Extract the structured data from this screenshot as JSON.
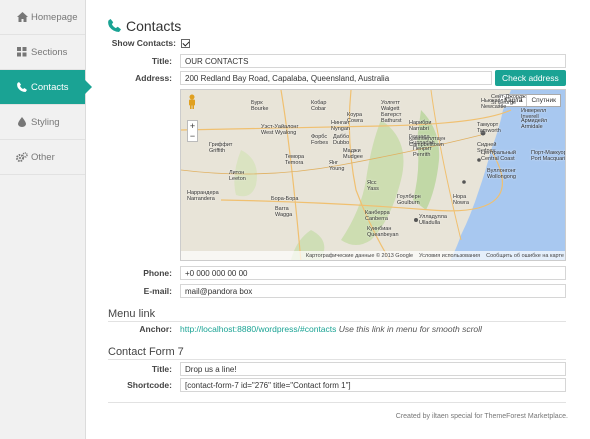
{
  "sidebar": {
    "items": [
      {
        "label": "Homepage",
        "icon": "home-icon"
      },
      {
        "label": "Sections",
        "icon": "grid-icon"
      },
      {
        "label": "Contacts",
        "icon": "phone-icon",
        "active": true
      },
      {
        "label": "Styling",
        "icon": "drop-icon"
      },
      {
        "label": "Other",
        "icon": "gears-icon"
      }
    ]
  },
  "header": {
    "title": "Contacts",
    "icon": "phone-icon"
  },
  "form": {
    "show_contacts_label": "Show Contacts:",
    "show_contacts_checked": true,
    "title_label": "Title:",
    "title_value": "OUR CONTACTS",
    "address_label": "Address:",
    "address_value": "200 Redland Bay Road, Capalaba, Queensland, Australia",
    "check_address_button": "Check address",
    "phone_label": "Phone:",
    "phone_value": "+0 000 000 00 00",
    "email_label": "E-mail:",
    "email_value": "mail@pandora box"
  },
  "map": {
    "type_map": "Карта",
    "type_satellite": "Спутник",
    "zoom_in": "+",
    "zoom_out": "−",
    "attribution": "Картографические данные © 2013 Google",
    "terms": "Условия использования",
    "report": "Сообщить об ошибке на карте",
    "places": [
      {
        "name": "Сент-Джордж",
        "sub": "St George"
      },
      {
        "name": "Инверелл",
        "sub": "Inverell"
      },
      {
        "name": "Армидейл",
        "sub": "Armidale"
      },
      {
        "name": "Тамуорт",
        "sub": "Tamworth"
      },
      {
        "name": "Порт-Маккуори",
        "sub": "Port Macquarie"
      },
      {
        "name": "Уолгетт",
        "sub": "Walgett"
      },
      {
        "name": "Бурк",
        "sub": "Bourke"
      },
      {
        "name": "Нарибри",
        "sub": "Narrabri"
      },
      {
        "name": "Гуннеда",
        "sub": "Gunnedah"
      },
      {
        "name": "Кобар",
        "sub": "Cobar"
      },
      {
        "name": "Нинган",
        "sub": "Nyngan"
      },
      {
        "name": "Даббо",
        "sub": "Dubbo"
      },
      {
        "name": "Маджи",
        "sub": "Mudgee"
      },
      {
        "name": "Форбс",
        "sub": "Forbes"
      },
      {
        "name": "Коура",
        "sub": "Cowra"
      },
      {
        "name": "Батерст",
        "sub": "Bathurst"
      },
      {
        "name": "Пенрит",
        "sub": "Penrith"
      },
      {
        "name": "Сидней",
        "sub": "Sydney"
      },
      {
        "name": "Ньюкасл",
        "sub": "Newcastle"
      },
      {
        "name": "Центральный",
        "sub": "Central Coast"
      },
      {
        "name": "Уэст-Уайалонг",
        "sub": "West Wyalong"
      },
      {
        "name": "Гриффит",
        "sub": "Griffith"
      },
      {
        "name": "Литон",
        "sub": "Leeton"
      },
      {
        "name": "Темора",
        "sub": "Temora"
      },
      {
        "name": "Янг",
        "sub": "Young"
      },
      {
        "name": "Кэмпбеллтаун",
        "sub": "Campbelltown"
      },
      {
        "name": "Вуллонгонг",
        "sub": "Wollongong"
      },
      {
        "name": "Наррандера",
        "sub": "Narrandera"
      },
      {
        "name": "Бора-Бора",
        "sub": ""
      },
      {
        "name": "Вагга",
        "sub": "Wagga"
      },
      {
        "name": "Ясс",
        "sub": "Yass"
      },
      {
        "name": "Гоулберн",
        "sub": "Goulburn"
      },
      {
        "name": "Канберра",
        "sub": "Canberra"
      },
      {
        "name": "Куинбиан",
        "sub": "Queanbeyan"
      },
      {
        "name": "Нора",
        "sub": "Nowra"
      },
      {
        "name": "Улладулла",
        "sub": "Ulladulla"
      }
    ]
  },
  "menu_link": {
    "heading": "Menu link",
    "anchor_label": "Anchor:",
    "anchor_url": "http://localhost:8880/wordpress/#contacts",
    "anchor_note": "Use this link in menu for smooth scroll"
  },
  "contact_form": {
    "heading": "Contact Form 7",
    "title_label": "Title:",
    "title_value": "Drop us a line!",
    "shortcode_label": "Shortcode:",
    "shortcode_value": "[contact-form-7 id=\"276\" title=\"Contact form 1\"]"
  },
  "footer": {
    "text": "Created by iltaen special for ThemeForest Marketplace."
  },
  "colors": {
    "accent": "#1aa394",
    "sidebar_bg": "#f1f1f1",
    "water": "#a8c8f0",
    "land": "#e8e4d8"
  }
}
